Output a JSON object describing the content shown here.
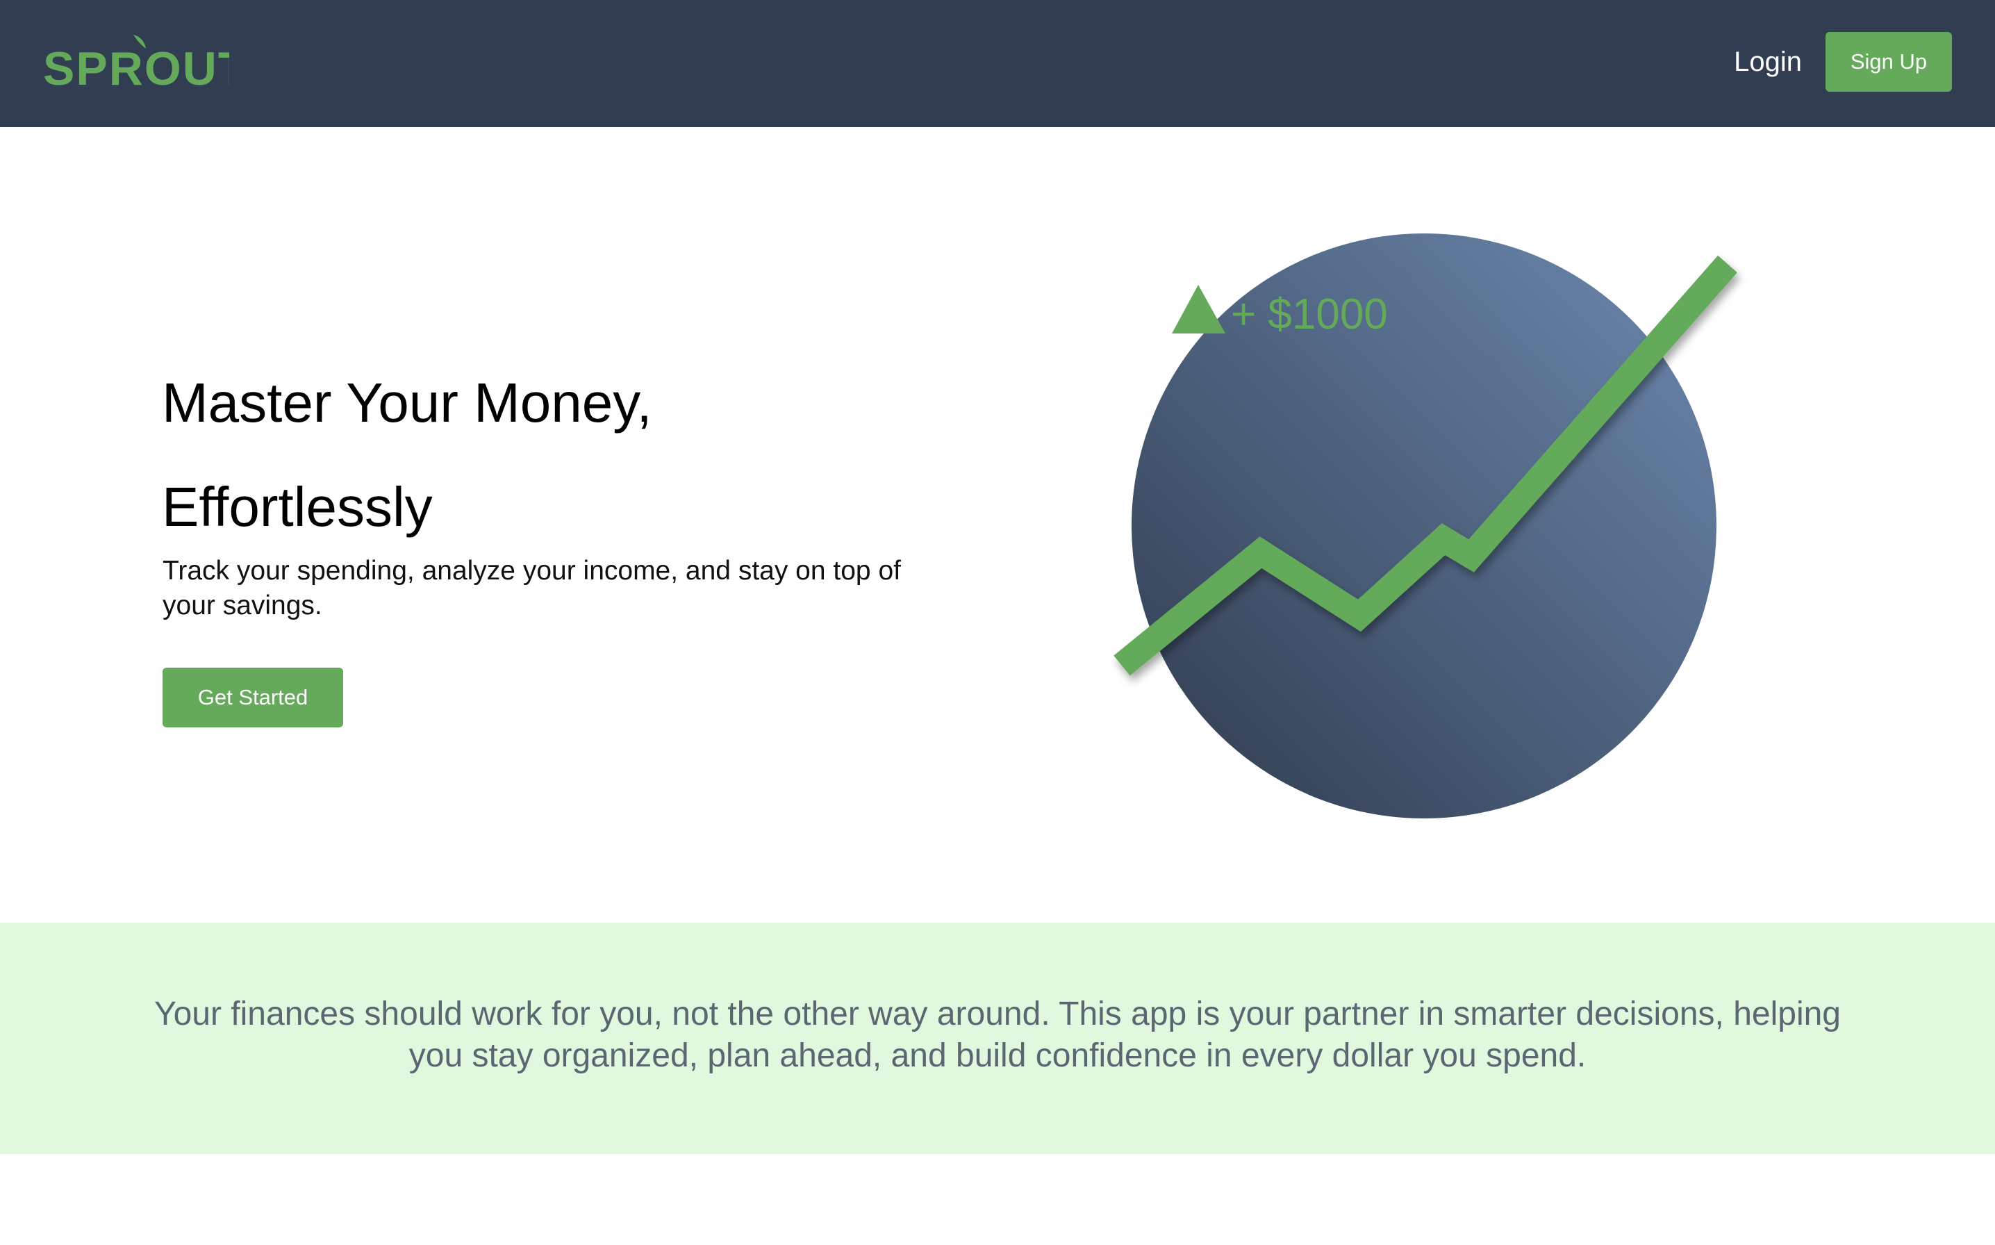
{
  "brand": {
    "name": "SPROUT",
    "color": "#64aa5a"
  },
  "nav": {
    "login_label": "Login",
    "signup_label": "Sign Up"
  },
  "hero": {
    "title": "Master Your Money, Effortlessly",
    "subtitle": "Track your spending, analyze your income, and stay on top of your savings.",
    "cta_label": "Get Started",
    "graphic": {
      "gain_label": "+ $1000",
      "circle_gradient": [
        "#2f3a4d",
        "#6d8ab0"
      ],
      "line_color": "#64aa5a"
    }
  },
  "mission": {
    "text": "Your finances should work for you, not the other way around. This app is your partner in smarter decisions, helping you stay organized, plan ahead, and build confidence in every dollar you spend."
  },
  "colors": {
    "navbar_bg": "#313d50",
    "accent": "#64aa5a",
    "mission_bg": "#e0f8dd"
  }
}
